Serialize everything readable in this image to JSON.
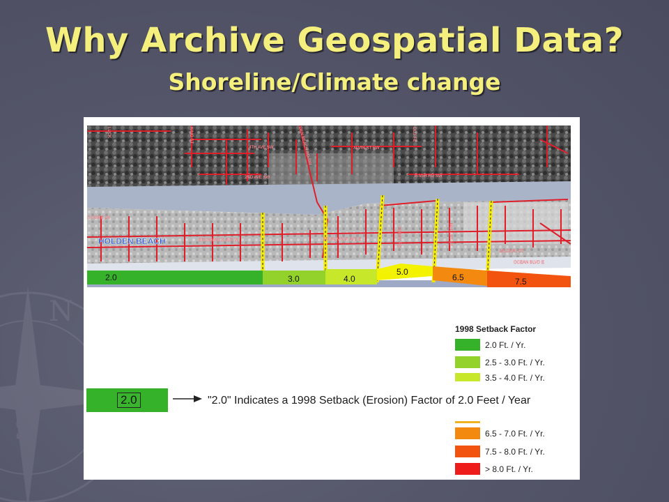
{
  "slide": {
    "title": "Why Archive Geospatial Data?",
    "subtitle": "Shoreline/Climate change"
  },
  "map": {
    "place_label": "HOLDEN BEACH",
    "street_labels": [
      "4TH AVE SW",
      "2ND AVE SW",
      "ALVIN ST SW",
      "B-VAR RD SW",
      "BRUNSWICK AVE W",
      "BRUNSWICK AVE E",
      "FERRY RD",
      "MULLET ST",
      "MCCRAY ST",
      "OCEAN BLVD E",
      "O DUNE LN",
      "KING ST",
      "LUCK",
      "OLD FE",
      "DEN BEACH RD SW"
    ],
    "segments": [
      {
        "label": "2.0",
        "color": "#35b12a"
      },
      {
        "label": "3.0",
        "color": "#93d22a"
      },
      {
        "label": "4.0",
        "color": "#c7e82a"
      },
      {
        "label": "5.0",
        "color": "#f3f200"
      },
      {
        "label": "6.5",
        "color": "#f3890e"
      },
      {
        "label": "7.5",
        "color": "#f2540f"
      }
    ]
  },
  "legend": {
    "title": "1998 Setback Factor",
    "items": [
      {
        "label": "2.0 Ft. / Yr.",
        "color": "#35b12a"
      },
      {
        "label": "2.5 - 3.0 Ft. / Yr.",
        "color": "#93d22a"
      },
      {
        "label": "3.5 - 4.0 Ft. / Yr.",
        "color": "#c7e82a"
      },
      {
        "label": "6.5 - 7.0 Ft. / Yr.",
        "color": "#f3890e"
      },
      {
        "label": "7.5 - 8.0 Ft. / Yr.",
        "color": "#f2540f"
      },
      {
        "label": "> 8.0 Ft. / Yr.",
        "color": "#ef1c1c"
      }
    ]
  },
  "example": {
    "box_label": "2.0",
    "text": "\"2.0\" Indicates a 1998 Setback (Erosion)  Factor of 2.0 Feet / Year"
  },
  "colors": {
    "title_text": "#f5ef7d",
    "background": "#55566a"
  }
}
